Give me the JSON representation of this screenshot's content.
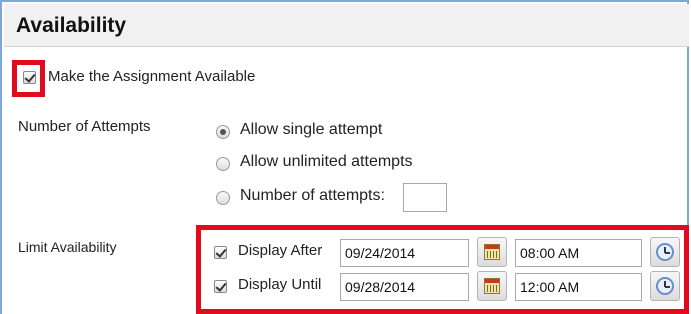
{
  "section": {
    "title": "Availability"
  },
  "make_available": {
    "label": "Make the Assignment Available",
    "checked": true
  },
  "attempts": {
    "label": "Number of Attempts",
    "options": [
      {
        "label": "Allow single attempt",
        "selected": true
      },
      {
        "label": "Allow unlimited attempts",
        "selected": false
      },
      {
        "label": "Number of attempts:",
        "selected": false
      }
    ],
    "count_value": ""
  },
  "limit": {
    "label": "Limit Availability",
    "display_after": {
      "label": "Display After",
      "checked": true,
      "date": "09/24/2014",
      "time": "08:00 AM"
    },
    "display_until": {
      "label": "Display Until",
      "checked": true,
      "date": "09/28/2014",
      "time": "12:00 AM"
    }
  },
  "icons": {
    "date_picker": "calendar-icon",
    "time_picker": "clock-icon"
  },
  "colors": {
    "highlight": "#e00b1c",
    "header_bg": "#f1f1f1",
    "panel_border": "#7fa6d6"
  }
}
